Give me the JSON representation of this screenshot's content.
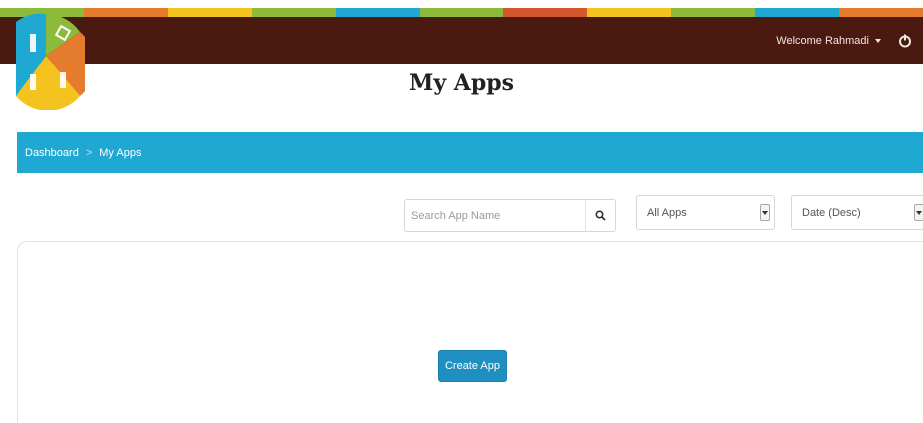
{
  "header": {
    "strip_colors": [
      "#8cba3a",
      "#e57b2c",
      "#f4c320",
      "#8cba3a",
      "#1fa8d2",
      "#8cba3a",
      "#d4582c",
      "#f4c320",
      "#8cba3a",
      "#1fa8d2",
      "#e57b2c"
    ],
    "welcome_text": "Welcome Rahmadi",
    "user_menu_icon": "caret-down-icon",
    "power_icon": "power-icon",
    "logo_icon": "app-logo-icon",
    "logo_colors": [
      "#f4c320",
      "#8cba3a",
      "#1fa8d2",
      "#e57b2c"
    ]
  },
  "page": {
    "title": "My Apps"
  },
  "breadcrumb": {
    "items": [
      {
        "label": "Dashboard"
      },
      {
        "label": "My Apps"
      }
    ],
    "separator": ">"
  },
  "filters": {
    "search_placeholder": "Search App Name",
    "search_value": "",
    "search_icon": "search-icon",
    "filter_selected": "All Apps",
    "sort_selected": "Date (Desc)"
  },
  "apps_panel": {
    "create_label": "Create App"
  },
  "colors": {
    "topbar": "#4a1a11",
    "breadcrumb_bar": "#1fa8d2",
    "primary_button": "#1f8fc1"
  }
}
